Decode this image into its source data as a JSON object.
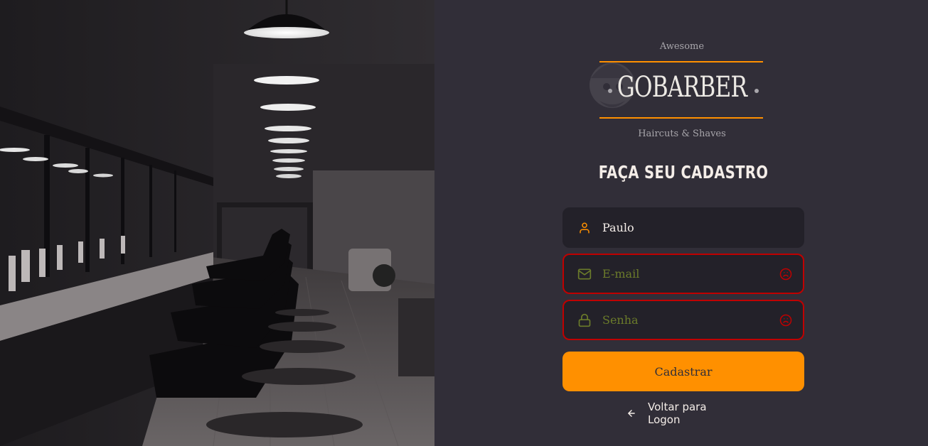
{
  "brand": {
    "top_text": "Awesome",
    "name": "GOBARBER",
    "bottom_text": "Haircuts & Shaves"
  },
  "form": {
    "title": "FAÇA SEU CADASTRO",
    "name_value": "Paulo",
    "email_placeholder": "E-mail",
    "password_placeholder": "Senha",
    "submit_label": "Cadastrar"
  },
  "back_link": {
    "label": "Voltar para Logon"
  },
  "colors": {
    "background": "#312e38",
    "input_background": "#232129",
    "accent": "#ff9000",
    "error": "#c53030",
    "text": "#f4ede8"
  },
  "icons": {
    "name_field": "user-icon",
    "email_field": "mail-icon",
    "password_field": "lock-icon",
    "error": "frown-icon",
    "back": "arrow-left-icon"
  }
}
